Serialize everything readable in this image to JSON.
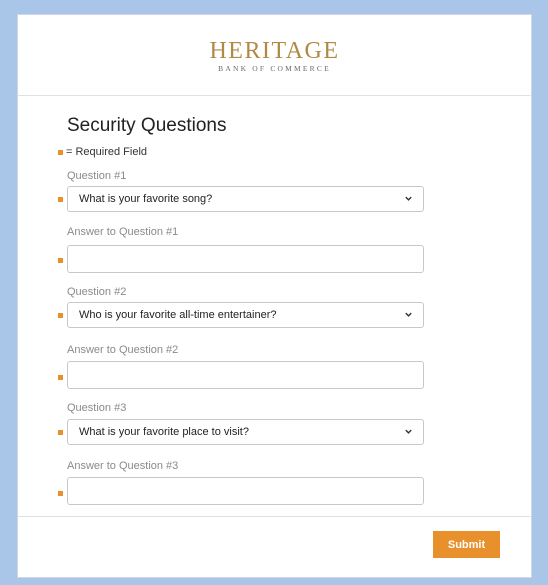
{
  "logo": {
    "name": "HERITAGE",
    "subtitle": "BANK OF COMMERCE"
  },
  "form": {
    "title": "Security Questions",
    "required_note": "= Required Field",
    "questions": [
      {
        "label": "Question #1",
        "selected": "What is your favorite song?",
        "answer_label": "Answer to Question #1",
        "answer_value": ""
      },
      {
        "label": "Question #2",
        "selected": "Who is your favorite all-time entertainer?",
        "answer_label": "Answer to Question #2",
        "answer_value": ""
      },
      {
        "label": "Question #3",
        "selected": "What is your favorite place to visit?",
        "answer_label": "Answer to Question #3",
        "answer_value": ""
      }
    ]
  },
  "footer": {
    "submit_label": "Submit"
  },
  "colors": {
    "accent": "#e8902c",
    "background": "#a9c5e8",
    "logo": "#b08a45"
  }
}
